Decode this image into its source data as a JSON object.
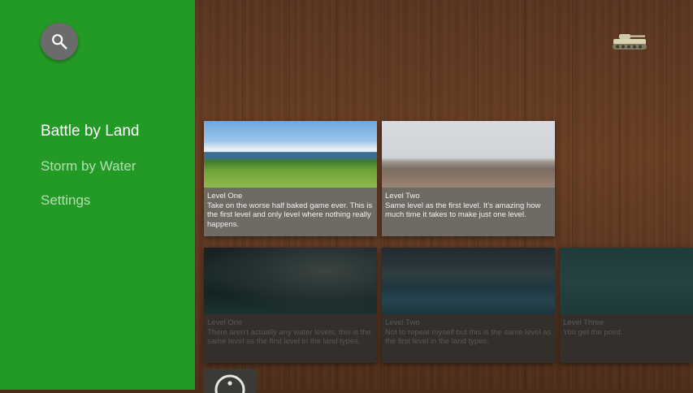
{
  "sidebar": {
    "search_icon": "search-icon",
    "items": [
      {
        "label": "Battle by Land",
        "active": true
      },
      {
        "label": "Storm by Water",
        "active": false
      },
      {
        "label": "Settings",
        "active": false
      }
    ]
  },
  "header": {
    "badge_icon": "tank-icon"
  },
  "rows": [
    {
      "cards": [
        {
          "title": "Level One",
          "description": "Take on the worse half baked game ever. This is the first level and only level where nothing really happens."
        },
        {
          "title": "Level Two",
          "description": "Same level as the first level. It's amazing how much time it takes to make just one level."
        }
      ]
    },
    {
      "cards": [
        {
          "title": "Level One",
          "description": "There aren't actually any water levels, this is the same level as the first level in the land types."
        },
        {
          "title": "Level Two",
          "description": "Not to repeat myself but this is the same level as the first level in the land types."
        },
        {
          "title": "Level Three",
          "description": "You get the point."
        }
      ]
    }
  ],
  "colors": {
    "sidebar_bg": "#239a26",
    "search_button": "#6b6b6b",
    "active_text": "#ffffff",
    "inactive_text": "#b8dcb8"
  }
}
